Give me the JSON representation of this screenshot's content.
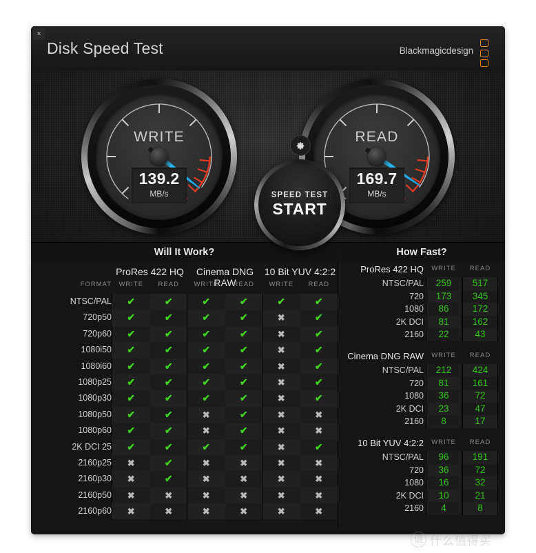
{
  "window": {
    "title": "Disk Speed Test",
    "brand": "Blackmagicdesign",
    "close_label": "×",
    "logo_name": "blackmagic-logo"
  },
  "gauges": {
    "write": {
      "label": "WRITE",
      "value": "139.2",
      "unit": "MB/s",
      "needle_angle_deg": 218
    },
    "read": {
      "label": "READ",
      "value": "169.7",
      "unit": "MB/s",
      "needle_angle_deg": 214
    },
    "needle_color": "#27b8f2",
    "redzone_color": "#e03b23"
  },
  "start_button": {
    "sub_label": "SPEED TEST",
    "main_label": "START"
  },
  "settings_button": {
    "icon": "gear-icon"
  },
  "will_it_work": {
    "header": "Will It Work?",
    "format_label": "FORMAT",
    "groups": [
      "ProRes 422 HQ",
      "Cinema DNG RAW",
      "10 Bit YUV 4:2:2"
    ],
    "sub_columns": [
      "WRITE",
      "READ",
      "WRITE",
      "READ",
      "WRITE",
      "READ"
    ],
    "ok_glyph": "✔",
    "no_glyph": "✖",
    "rows": [
      {
        "format": "NTSC/PAL",
        "cells": [
          true,
          true,
          true,
          true,
          true,
          true
        ]
      },
      {
        "format": "720p50",
        "cells": [
          true,
          true,
          true,
          true,
          false,
          true
        ]
      },
      {
        "format": "720p60",
        "cells": [
          true,
          true,
          true,
          true,
          false,
          true
        ]
      },
      {
        "format": "1080i50",
        "cells": [
          true,
          true,
          true,
          true,
          false,
          true
        ]
      },
      {
        "format": "1080i60",
        "cells": [
          true,
          true,
          true,
          true,
          false,
          true
        ]
      },
      {
        "format": "1080p25",
        "cells": [
          true,
          true,
          true,
          true,
          false,
          true
        ]
      },
      {
        "format": "1080p30",
        "cells": [
          true,
          true,
          true,
          true,
          false,
          true
        ]
      },
      {
        "format": "1080p50",
        "cells": [
          true,
          true,
          false,
          true,
          false,
          false
        ]
      },
      {
        "format": "1080p60",
        "cells": [
          true,
          true,
          false,
          true,
          false,
          false
        ]
      },
      {
        "format": "2K DCI 25",
        "cells": [
          true,
          true,
          true,
          true,
          false,
          true
        ]
      },
      {
        "format": "2160p25",
        "cells": [
          false,
          true,
          false,
          false,
          false,
          false
        ]
      },
      {
        "format": "2160p30",
        "cells": [
          false,
          true,
          false,
          false,
          false,
          false
        ]
      },
      {
        "format": "2160p50",
        "cells": [
          false,
          false,
          false,
          false,
          false,
          false
        ]
      },
      {
        "format": "2160p60",
        "cells": [
          false,
          false,
          false,
          false,
          false,
          false
        ]
      }
    ]
  },
  "how_fast": {
    "header": "How Fast?",
    "col_write": "WRITE",
    "col_read": "READ",
    "sections": [
      {
        "title": "ProRes 422 HQ",
        "rows": [
          {
            "label": "NTSC/PAL",
            "write": "259",
            "read": "517"
          },
          {
            "label": "720",
            "write": "173",
            "read": "345"
          },
          {
            "label": "1080",
            "write": "86",
            "read": "172"
          },
          {
            "label": "2K DCI",
            "write": "81",
            "read": "162"
          },
          {
            "label": "2160",
            "write": "22",
            "read": "43"
          }
        ]
      },
      {
        "title": "Cinema DNG RAW",
        "rows": [
          {
            "label": "NTSC/PAL",
            "write": "212",
            "read": "424"
          },
          {
            "label": "720",
            "write": "81",
            "read": "161"
          },
          {
            "label": "1080",
            "write": "36",
            "read": "72"
          },
          {
            "label": "2K DCI",
            "write": "23",
            "read": "47"
          },
          {
            "label": "2160",
            "write": "8",
            "read": "17"
          }
        ]
      },
      {
        "title": "10 Bit YUV 4:2:2",
        "rows": [
          {
            "label": "NTSC/PAL",
            "write": "96",
            "read": "191"
          },
          {
            "label": "720",
            "write": "36",
            "read": "72"
          },
          {
            "label": "1080",
            "write": "16",
            "read": "32"
          },
          {
            "label": "2K DCI",
            "write": "10",
            "read": "21"
          },
          {
            "label": "2160",
            "write": "4",
            "read": "8"
          }
        ]
      }
    ]
  },
  "watermark": {
    "mark": "值",
    "text": "什么值得买"
  }
}
